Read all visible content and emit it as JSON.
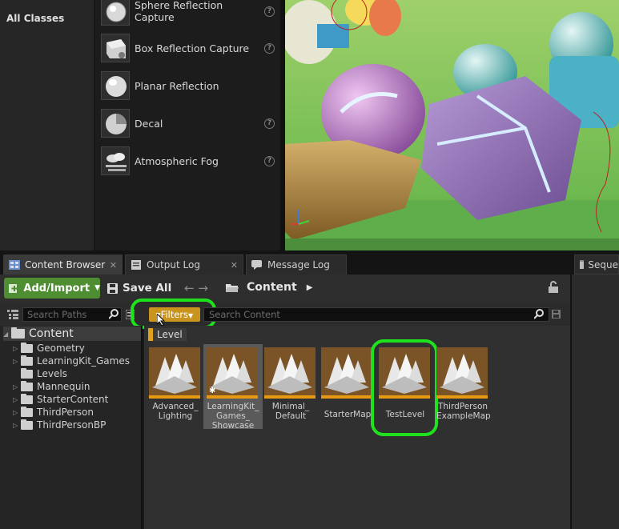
{
  "top": {
    "left_rail_label": "All Classes",
    "actors": [
      {
        "label": "Sphere Reflection Capture",
        "icon": "sphere-reflection-capture-icon",
        "help": true
      },
      {
        "label": "Box Reflection Capture",
        "icon": "box-reflection-capture-icon",
        "help": true
      },
      {
        "label": "Planar Reflection",
        "icon": "planar-reflection-icon",
        "help": false
      },
      {
        "label": "Decal",
        "icon": "decal-icon",
        "help": true
      },
      {
        "label": "Atmospheric Fog",
        "icon": "atmospheric-fog-icon",
        "help": true
      }
    ],
    "help_glyph": "?"
  },
  "tabs": [
    {
      "label": "Content Browser",
      "icon": "content-browser-icon",
      "active": true
    },
    {
      "label": "Output Log",
      "icon": "output-log-icon",
      "active": false
    },
    {
      "label": "Message Log",
      "icon": "message-log-icon",
      "active": false
    }
  ],
  "right_tab": {
    "label": "Seque",
    "icon": "sequencer-icon"
  },
  "toolbar": {
    "add_import": "Add/Import",
    "save_all": "Save All",
    "path_root": "Content"
  },
  "search": {
    "paths_placeholder": "Search Paths",
    "filters_label": "Filters",
    "content_placeholder": "Search Content"
  },
  "tree": {
    "root": "Content",
    "items": [
      {
        "label": "Geometry",
        "expandable": true
      },
      {
        "label": "LearningKit_Games",
        "expandable": true
      },
      {
        "label": "Levels",
        "expandable": false
      },
      {
        "label": "Mannequin",
        "expandable": true
      },
      {
        "label": "StarterContent",
        "expandable": true
      },
      {
        "label": "ThirdPerson",
        "expandable": true
      },
      {
        "label": "ThirdPersonBP",
        "expandable": true
      }
    ]
  },
  "content": {
    "filter_chip": "Level",
    "assets": [
      {
        "name": "Advanced_\nLighting",
        "selected": false,
        "highlighted": false
      },
      {
        "name": "LearningKit_\nGames_\nShowcase",
        "selected": true,
        "highlighted": false
      },
      {
        "name": "Minimal_\nDefault",
        "selected": false,
        "highlighted": false
      },
      {
        "name": "StarterMap",
        "selected": false,
        "highlighted": false
      },
      {
        "name": "TestLevel",
        "selected": false,
        "highlighted": true
      },
      {
        "name": "ThirdPerson\nExampleMap",
        "selected": false,
        "highlighted": false
      }
    ]
  },
  "colors": {
    "add_import_bg": "#4f8d32",
    "filters_bg": "#c9941e",
    "level_asset_stripe": "#e69a13",
    "annotation_highlight": "#1fe21f"
  }
}
